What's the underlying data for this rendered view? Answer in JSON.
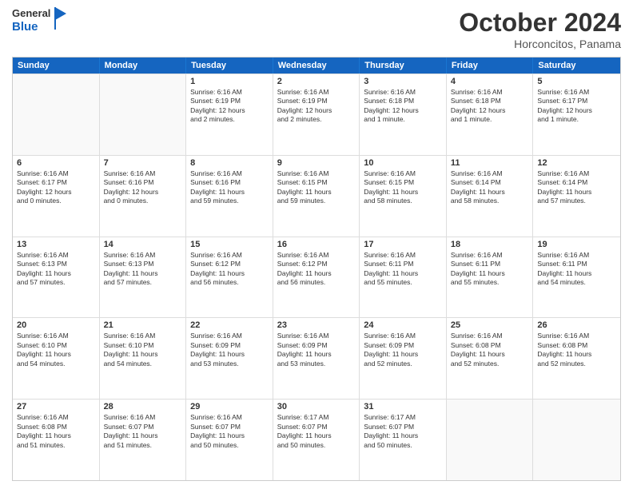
{
  "logo": {
    "line1": "General",
    "line2": "Blue"
  },
  "title": "October 2024",
  "location": "Horconcitos, Panama",
  "days": [
    "Sunday",
    "Monday",
    "Tuesday",
    "Wednesday",
    "Thursday",
    "Friday",
    "Saturday"
  ],
  "weeks": [
    [
      {
        "day": "",
        "info": ""
      },
      {
        "day": "",
        "info": ""
      },
      {
        "day": "1",
        "info": "Sunrise: 6:16 AM\nSunset: 6:19 PM\nDaylight: 12 hours\nand 2 minutes."
      },
      {
        "day": "2",
        "info": "Sunrise: 6:16 AM\nSunset: 6:19 PM\nDaylight: 12 hours\nand 2 minutes."
      },
      {
        "day": "3",
        "info": "Sunrise: 6:16 AM\nSunset: 6:18 PM\nDaylight: 12 hours\nand 1 minute."
      },
      {
        "day": "4",
        "info": "Sunrise: 6:16 AM\nSunset: 6:18 PM\nDaylight: 12 hours\nand 1 minute."
      },
      {
        "day": "5",
        "info": "Sunrise: 6:16 AM\nSunset: 6:17 PM\nDaylight: 12 hours\nand 1 minute."
      }
    ],
    [
      {
        "day": "6",
        "info": "Sunrise: 6:16 AM\nSunset: 6:17 PM\nDaylight: 12 hours\nand 0 minutes."
      },
      {
        "day": "7",
        "info": "Sunrise: 6:16 AM\nSunset: 6:16 PM\nDaylight: 12 hours\nand 0 minutes."
      },
      {
        "day": "8",
        "info": "Sunrise: 6:16 AM\nSunset: 6:16 PM\nDaylight: 11 hours\nand 59 minutes."
      },
      {
        "day": "9",
        "info": "Sunrise: 6:16 AM\nSunset: 6:15 PM\nDaylight: 11 hours\nand 59 minutes."
      },
      {
        "day": "10",
        "info": "Sunrise: 6:16 AM\nSunset: 6:15 PM\nDaylight: 11 hours\nand 58 minutes."
      },
      {
        "day": "11",
        "info": "Sunrise: 6:16 AM\nSunset: 6:14 PM\nDaylight: 11 hours\nand 58 minutes."
      },
      {
        "day": "12",
        "info": "Sunrise: 6:16 AM\nSunset: 6:14 PM\nDaylight: 11 hours\nand 57 minutes."
      }
    ],
    [
      {
        "day": "13",
        "info": "Sunrise: 6:16 AM\nSunset: 6:13 PM\nDaylight: 11 hours\nand 57 minutes."
      },
      {
        "day": "14",
        "info": "Sunrise: 6:16 AM\nSunset: 6:13 PM\nDaylight: 11 hours\nand 57 minutes."
      },
      {
        "day": "15",
        "info": "Sunrise: 6:16 AM\nSunset: 6:12 PM\nDaylight: 11 hours\nand 56 minutes."
      },
      {
        "day": "16",
        "info": "Sunrise: 6:16 AM\nSunset: 6:12 PM\nDaylight: 11 hours\nand 56 minutes."
      },
      {
        "day": "17",
        "info": "Sunrise: 6:16 AM\nSunset: 6:11 PM\nDaylight: 11 hours\nand 55 minutes."
      },
      {
        "day": "18",
        "info": "Sunrise: 6:16 AM\nSunset: 6:11 PM\nDaylight: 11 hours\nand 55 minutes."
      },
      {
        "day": "19",
        "info": "Sunrise: 6:16 AM\nSunset: 6:11 PM\nDaylight: 11 hours\nand 54 minutes."
      }
    ],
    [
      {
        "day": "20",
        "info": "Sunrise: 6:16 AM\nSunset: 6:10 PM\nDaylight: 11 hours\nand 54 minutes."
      },
      {
        "day": "21",
        "info": "Sunrise: 6:16 AM\nSunset: 6:10 PM\nDaylight: 11 hours\nand 54 minutes."
      },
      {
        "day": "22",
        "info": "Sunrise: 6:16 AM\nSunset: 6:09 PM\nDaylight: 11 hours\nand 53 minutes."
      },
      {
        "day": "23",
        "info": "Sunrise: 6:16 AM\nSunset: 6:09 PM\nDaylight: 11 hours\nand 53 minutes."
      },
      {
        "day": "24",
        "info": "Sunrise: 6:16 AM\nSunset: 6:09 PM\nDaylight: 11 hours\nand 52 minutes."
      },
      {
        "day": "25",
        "info": "Sunrise: 6:16 AM\nSunset: 6:08 PM\nDaylight: 11 hours\nand 52 minutes."
      },
      {
        "day": "26",
        "info": "Sunrise: 6:16 AM\nSunset: 6:08 PM\nDaylight: 11 hours\nand 52 minutes."
      }
    ],
    [
      {
        "day": "27",
        "info": "Sunrise: 6:16 AM\nSunset: 6:08 PM\nDaylight: 11 hours\nand 51 minutes."
      },
      {
        "day": "28",
        "info": "Sunrise: 6:16 AM\nSunset: 6:07 PM\nDaylight: 11 hours\nand 51 minutes."
      },
      {
        "day": "29",
        "info": "Sunrise: 6:16 AM\nSunset: 6:07 PM\nDaylight: 11 hours\nand 50 minutes."
      },
      {
        "day": "30",
        "info": "Sunrise: 6:17 AM\nSunset: 6:07 PM\nDaylight: 11 hours\nand 50 minutes."
      },
      {
        "day": "31",
        "info": "Sunrise: 6:17 AM\nSunset: 6:07 PM\nDaylight: 11 hours\nand 50 minutes."
      },
      {
        "day": "",
        "info": ""
      },
      {
        "day": "",
        "info": ""
      }
    ]
  ]
}
